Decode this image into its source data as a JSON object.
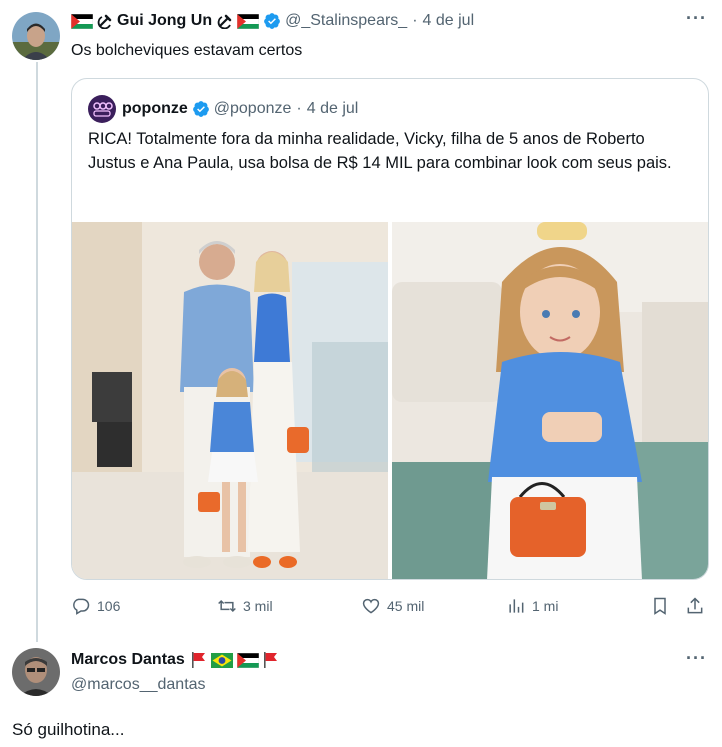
{
  "post1": {
    "display_name": "Gui Jong Un",
    "handle": "@_Stalinspears_",
    "separator": "·",
    "date": "4 de jul",
    "text": "Os bolcheviques estavam certos",
    "verified": true
  },
  "quote": {
    "display_name": "poponze",
    "handle": "@poponze",
    "separator": "·",
    "date": "4 de jul",
    "text": "RICA! Totalmente fora da minha realidade, Vicky, filha de 5 anos de Roberto Justus e Ana Paula, usa bolsa de R$ 14 MIL para combinar look com seus pais.",
    "verified": true
  },
  "actions": {
    "replies": "106",
    "reposts": "3 mil",
    "likes": "45 mil",
    "views": "1 mi"
  },
  "post2": {
    "display_name": "Marcos Dantas",
    "handle": "@marcos__dantas",
    "text": "Só guilhotina..."
  },
  "icons": [
    "reply-icon",
    "repost-icon",
    "like-icon",
    "views-icon",
    "bookmark-icon",
    "share-icon",
    "verified-badge-icon",
    "more-icon"
  ],
  "colors": {
    "verified": "#1d9bf0",
    "muted": "#536471",
    "border": "#cfd9de"
  }
}
